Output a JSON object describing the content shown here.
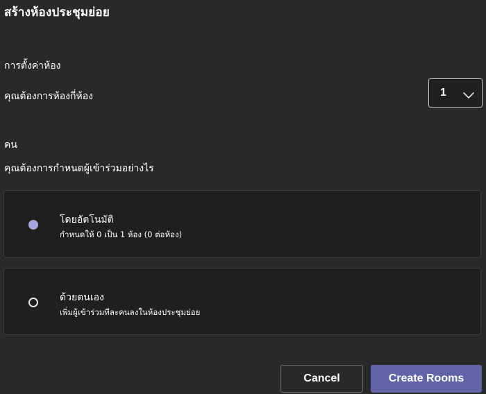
{
  "dialog": {
    "title": "สร้างห้องประชุมย่อย"
  },
  "room_settings": {
    "section_label": "การตั้งค่าห้อง",
    "rooms_question": "คุณต้องการห้องกี่ห้อง",
    "rooms_selected": "1",
    "people_label": "คน",
    "assign_question": "คุณต้องการกำหนดผู้เข้าร่วมอย่างไร"
  },
  "options": [
    {
      "title": "โดยอัตโนมัติ",
      "description": "กำหนดให้ 0 เป็น 1 ห้อง (0 ต่อห้อง)",
      "selected": true
    },
    {
      "title": "ด้วยตนเอง",
      "description": "เพิ่มผู้เข้าร่วมทีละคนลงในห้องประชุมย่อย",
      "selected": false
    }
  ],
  "buttons": {
    "cancel": "Cancel",
    "create": "Create Rooms"
  },
  "colors": {
    "background": "#292929",
    "card_background": "#1f1f1f",
    "accent": "#6264a7",
    "radio_selected": "#a5a4dc"
  },
  "icons": {
    "dropdown": "chevron-down-icon"
  }
}
